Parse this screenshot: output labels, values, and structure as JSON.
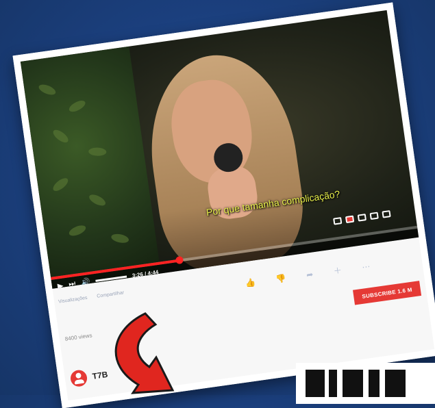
{
  "video": {
    "subtitle": "Por que tamanha complicação?",
    "time": "3:26 / 4:44",
    "progress_fraction": 0.35
  },
  "meta": {
    "links": [
      "Visualizações",
      "Compartilhar"
    ],
    "views": "8400 views",
    "subscribe": "SUBSCRIBE 1.6 M",
    "channel_name": "T7B"
  },
  "colors": {
    "brand_red": "#e53935",
    "background": "#1b3f7d",
    "like_blue": "#3a72d8"
  },
  "icons": [
    "play-icon",
    "next-icon",
    "volume-icon",
    "subtitles-icon",
    "settings-icon",
    "miniplayer-icon",
    "theater-icon",
    "fullscreen-icon",
    "like-icon",
    "dislike-icon",
    "share-icon",
    "save-icon",
    "more-icon",
    "avatar-icon",
    "arrow-icon"
  ]
}
